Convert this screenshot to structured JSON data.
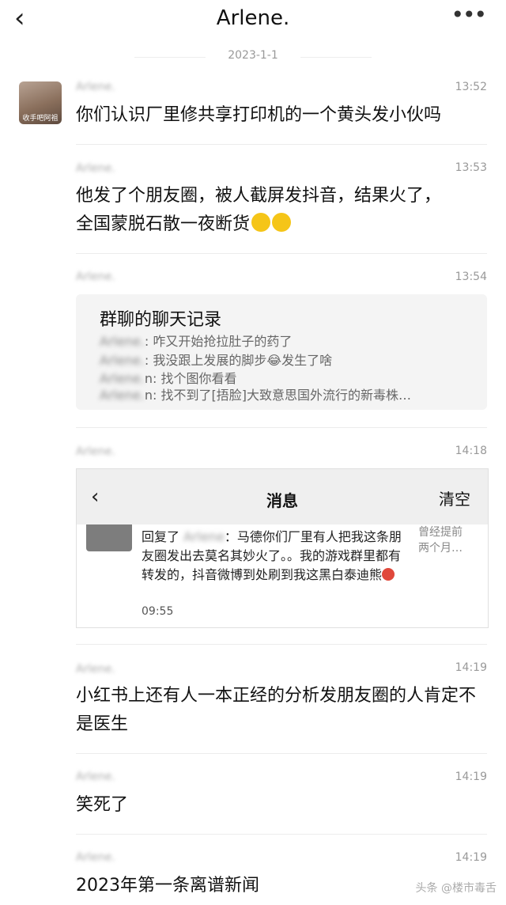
{
  "header": {
    "back_icon": "chevron-left-icon",
    "title": "Arlene.",
    "more_icon": "more-dots-icon"
  },
  "date": "2023-1-1",
  "avatar_caption": "收手吧阿祖",
  "messages": [
    {
      "sender": "Arlene.",
      "time": "13:52",
      "text": "你们认识厂里修共享打印机的一个黄头发小伙吗"
    },
    {
      "sender": "Arlene.",
      "time": "13:53",
      "text_line1": "他发了个朋友圈，被人截屏发抖音，结果火了，",
      "text_line2": "全国蒙脱石散一夜断货"
    },
    {
      "sender": "Arlene.",
      "time": "13:54"
    },
    {
      "sender": "Arlene.",
      "time": "14:18"
    },
    {
      "sender": "Arlene.",
      "time": "14:19",
      "text": "小红书上还有人一本正经的分析发朋友圈的人肯定不是医生"
    },
    {
      "sender": "Arlene.",
      "time": "14:19",
      "text": "笑死了"
    },
    {
      "sender": "Arlene.",
      "time": "14:19",
      "text": "2023年第一条离谱新闻"
    }
  ],
  "chat_record": {
    "title": "群聊的聊天记录",
    "lines": [
      {
        "who": "Arlene.",
        "text": ": 咋又开始抢拉肚子的药了"
      },
      {
        "who": "Arlene.",
        "text": ": 我没跟上发展的脚步😂发生了啥"
      },
      {
        "who": "Arlene.",
        "text": "n: 找个图你看看"
      },
      {
        "who": "Arlene.",
        "text": "n: 找不到了[捂脸]大致意思国外流行的新毒株…"
      }
    ]
  },
  "screenshot": {
    "back": "‹",
    "title": "消息",
    "clear": "清空",
    "reply_prefix": "回复了",
    "reply_blur": "Arlene",
    "reply_text": "：马德你们厂里有人把我这条朋友圈发出去莫名其妙火了。。我的游戏群里都有转发的，抖音微博到处刷到我这黑白泰迪熊",
    "reply_time": "09:55",
    "side_line1": "曾经提前",
    "side_line2": "两个月…"
  },
  "watermark": "头条 @楼市毒舌",
  "colors": {
    "background": "#ffffff",
    "card": "#f4f4f4",
    "meta_text": "#999999"
  }
}
